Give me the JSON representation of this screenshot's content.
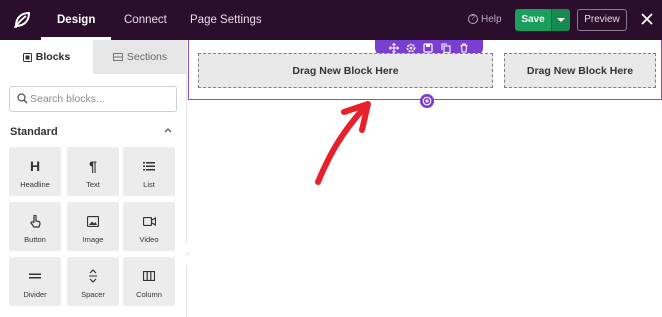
{
  "topbar": {
    "tabs": [
      {
        "label": "Design",
        "active": true
      },
      {
        "label": "Connect",
        "active": false
      },
      {
        "label": "Page Settings",
        "active": false
      }
    ],
    "help_label": "Help",
    "save_label": "Save",
    "preview_label": "Preview",
    "close_icon": "close-icon",
    "logo_icon": "seedling-logo-icon"
  },
  "sidebar": {
    "tabs": [
      {
        "label": "Blocks",
        "icon": "blocks-icon",
        "active": true
      },
      {
        "label": "Sections",
        "icon": "sections-icon",
        "active": false
      }
    ],
    "search": {
      "value": "",
      "placeholder": "Search blocks..."
    },
    "group_title": "Standard",
    "blocks": [
      {
        "label": "Headline",
        "icon": "headline-icon"
      },
      {
        "label": "Text",
        "icon": "paragraph-icon"
      },
      {
        "label": "List",
        "icon": "list-icon"
      },
      {
        "label": "Button",
        "icon": "pointer-hand-icon"
      },
      {
        "label": "Image",
        "icon": "image-icon"
      },
      {
        "label": "Video",
        "icon": "video-icon"
      },
      {
        "label": "Divider",
        "icon": "divider-icon"
      },
      {
        "label": "Spacer",
        "icon": "spacer-icon"
      },
      {
        "label": "Column",
        "icon": "column-icon"
      }
    ]
  },
  "canvas": {
    "drop_zones": [
      {
        "label": "Drag New Block Here"
      },
      {
        "label": "Drag New Block Here"
      }
    ],
    "row_toolbar_icons": [
      "move-icon",
      "settings-icon",
      "save-icon",
      "duplicate-icon",
      "delete-icon"
    ],
    "add_row_icon": "add-row-icon",
    "annotation": "red-arrow-annotation"
  },
  "colors": {
    "topbar_bg": "#2a0e2c",
    "save_green": "#1a9e5c",
    "accent_purple": "#7b3fd0",
    "annotation_red": "#e8202a"
  }
}
